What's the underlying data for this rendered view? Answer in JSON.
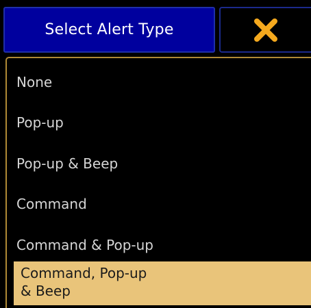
{
  "header": {
    "title": "Select Alert Type",
    "close_icon": "close-x-icon",
    "close_color": "#f5a91e"
  },
  "options": [
    {
      "label": "None",
      "selected": false
    },
    {
      "label": "Pop-up",
      "selected": false
    },
    {
      "label": "Pop-up & Beep",
      "selected": false
    },
    {
      "label": "Command",
      "selected": false
    },
    {
      "label": "Command & Pop-up",
      "selected": false
    },
    {
      "label_line1": "Command, Pop-up",
      "label_line2": "& Beep",
      "selected": true
    }
  ],
  "colors": {
    "background": "#000000",
    "title_bg": "#00009e",
    "panel_border": "#b08a36",
    "selected_bg": "#e9c47a",
    "text": "#d6d6d6"
  }
}
